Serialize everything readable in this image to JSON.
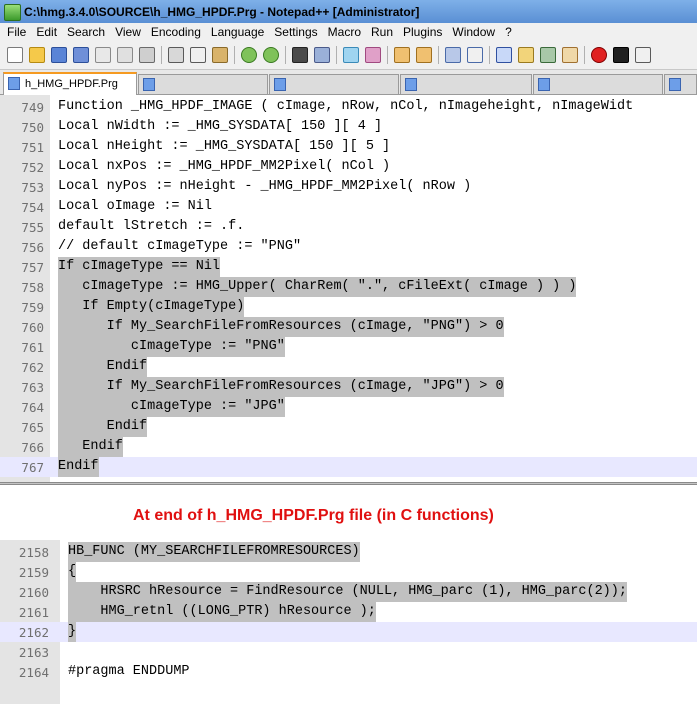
{
  "window": {
    "title": "C:\\hmg.3.4.0\\SOURCE\\h_HMG_HPDF.Prg - Notepad++ [Administrator]"
  },
  "menu": [
    "File",
    "Edit",
    "Search",
    "View",
    "Encoding",
    "Language",
    "Settings",
    "Macro",
    "Run",
    "Plugins",
    "Window",
    "?"
  ],
  "tabs": {
    "active": "h_HMG_HPDF.Prg"
  },
  "pane1": {
    "lines": [
      {
        "n": "749",
        "text": "Function _HMG_HPDF_IMAGE ( cImage, nRow, nCol, nImageheight, nImageWidt"
      },
      {
        "n": "750",
        "text": "Local nWidth := _HMG_SYSDATA[ 150 ][ 4 ]"
      },
      {
        "n": "751",
        "text": "Local nHeight := _HMG_SYSDATA[ 150 ][ 5 ]"
      },
      {
        "n": "752",
        "text": "Local nxPos := _HMG_HPDF_MM2Pixel( nCol )"
      },
      {
        "n": "753",
        "text": "Local nyPos := nHeight - _HMG_HPDF_MM2Pixel( nRow )"
      },
      {
        "n": "754",
        "text": "Local oImage := Nil"
      },
      {
        "n": "755",
        "text": "default lStretch := .f."
      },
      {
        "n": "756",
        "text": "// default cImageType := \"PNG\""
      },
      {
        "n": "757",
        "text": "If cImageType == Nil"
      },
      {
        "n": "758",
        "text": "   cImageType := HMG_Upper( CharRem( \".\", cFileExt( cImage ) ) )"
      },
      {
        "n": "759",
        "text": "   If Empty(cImageType)"
      },
      {
        "n": "760",
        "text": "      If My_SearchFileFromResources (cImage, \"PNG\") > 0"
      },
      {
        "n": "761",
        "text": "         cImageType := \"PNG\""
      },
      {
        "n": "762",
        "text": "      Endif"
      },
      {
        "n": "763",
        "text": "      If My_SearchFileFromResources (cImage, \"JPG\") > 0"
      },
      {
        "n": "764",
        "text": "         cImageType := \"JPG\""
      },
      {
        "n": "765",
        "text": "      Endif"
      },
      {
        "n": "766",
        "text": "   Endif"
      },
      {
        "n": "767",
        "text": "Endif"
      }
    ]
  },
  "annotation": "At end of h_HMG_HPDF.Prg file (in C functions)",
  "pane2": {
    "lines": [
      {
        "n": "2158",
        "text": "HB_FUNC (MY_SEARCHFILEFROMRESOURCES)"
      },
      {
        "n": "2159",
        "text": "{"
      },
      {
        "n": "2160",
        "text": "    HRSRC hResource = FindResource (NULL, HMG_parc (1), HMG_parc(2));"
      },
      {
        "n": "2161",
        "text": "    HMG_retnl ((LONG_PTR) hResource );"
      },
      {
        "n": "2162",
        "text": "}"
      },
      {
        "n": "2163",
        "text": ""
      },
      {
        "n": "2164",
        "text": "#pragma ENDDUMP"
      }
    ]
  }
}
